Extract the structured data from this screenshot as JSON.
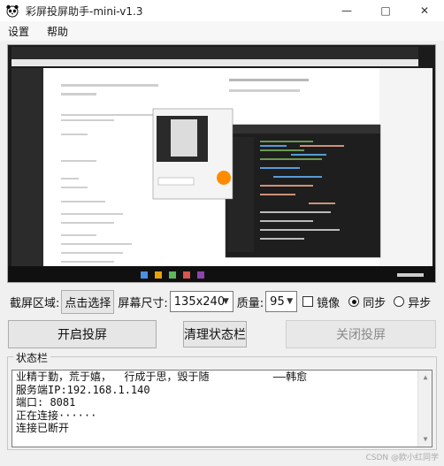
{
  "window": {
    "title": "彩屏投屏助手-mini-v1.3"
  },
  "menu": {
    "items": [
      "设置",
      "帮助"
    ]
  },
  "controls": {
    "capture_label": "截屏区域:",
    "select_button": "点击选择",
    "size_label": "屏幕尺寸:",
    "size_value": "135x240",
    "quality_label": "质量:",
    "quality_value": "95",
    "mirror_label": "镜像",
    "mirror_checked": false,
    "sync_label": "同步",
    "async_label": "异步",
    "mode_selected": "同步"
  },
  "actions": {
    "start": "开启投屏",
    "clear": "清理状态栏",
    "stop": "关闭投屏"
  },
  "status": {
    "title": "状态栏",
    "lines": [
      "业精于勤，荒于嬉，  行成于思，毁于随          ——韩愈",
      "服务端IP:192.168.1.140",
      "端口: 8081",
      "正在连接······",
      "连接已断开"
    ]
  },
  "watermark": "CSDN @欧小红同学",
  "colors": {
    "accent": "#ff8c00",
    "preview_bg": "#1b1b1b"
  }
}
